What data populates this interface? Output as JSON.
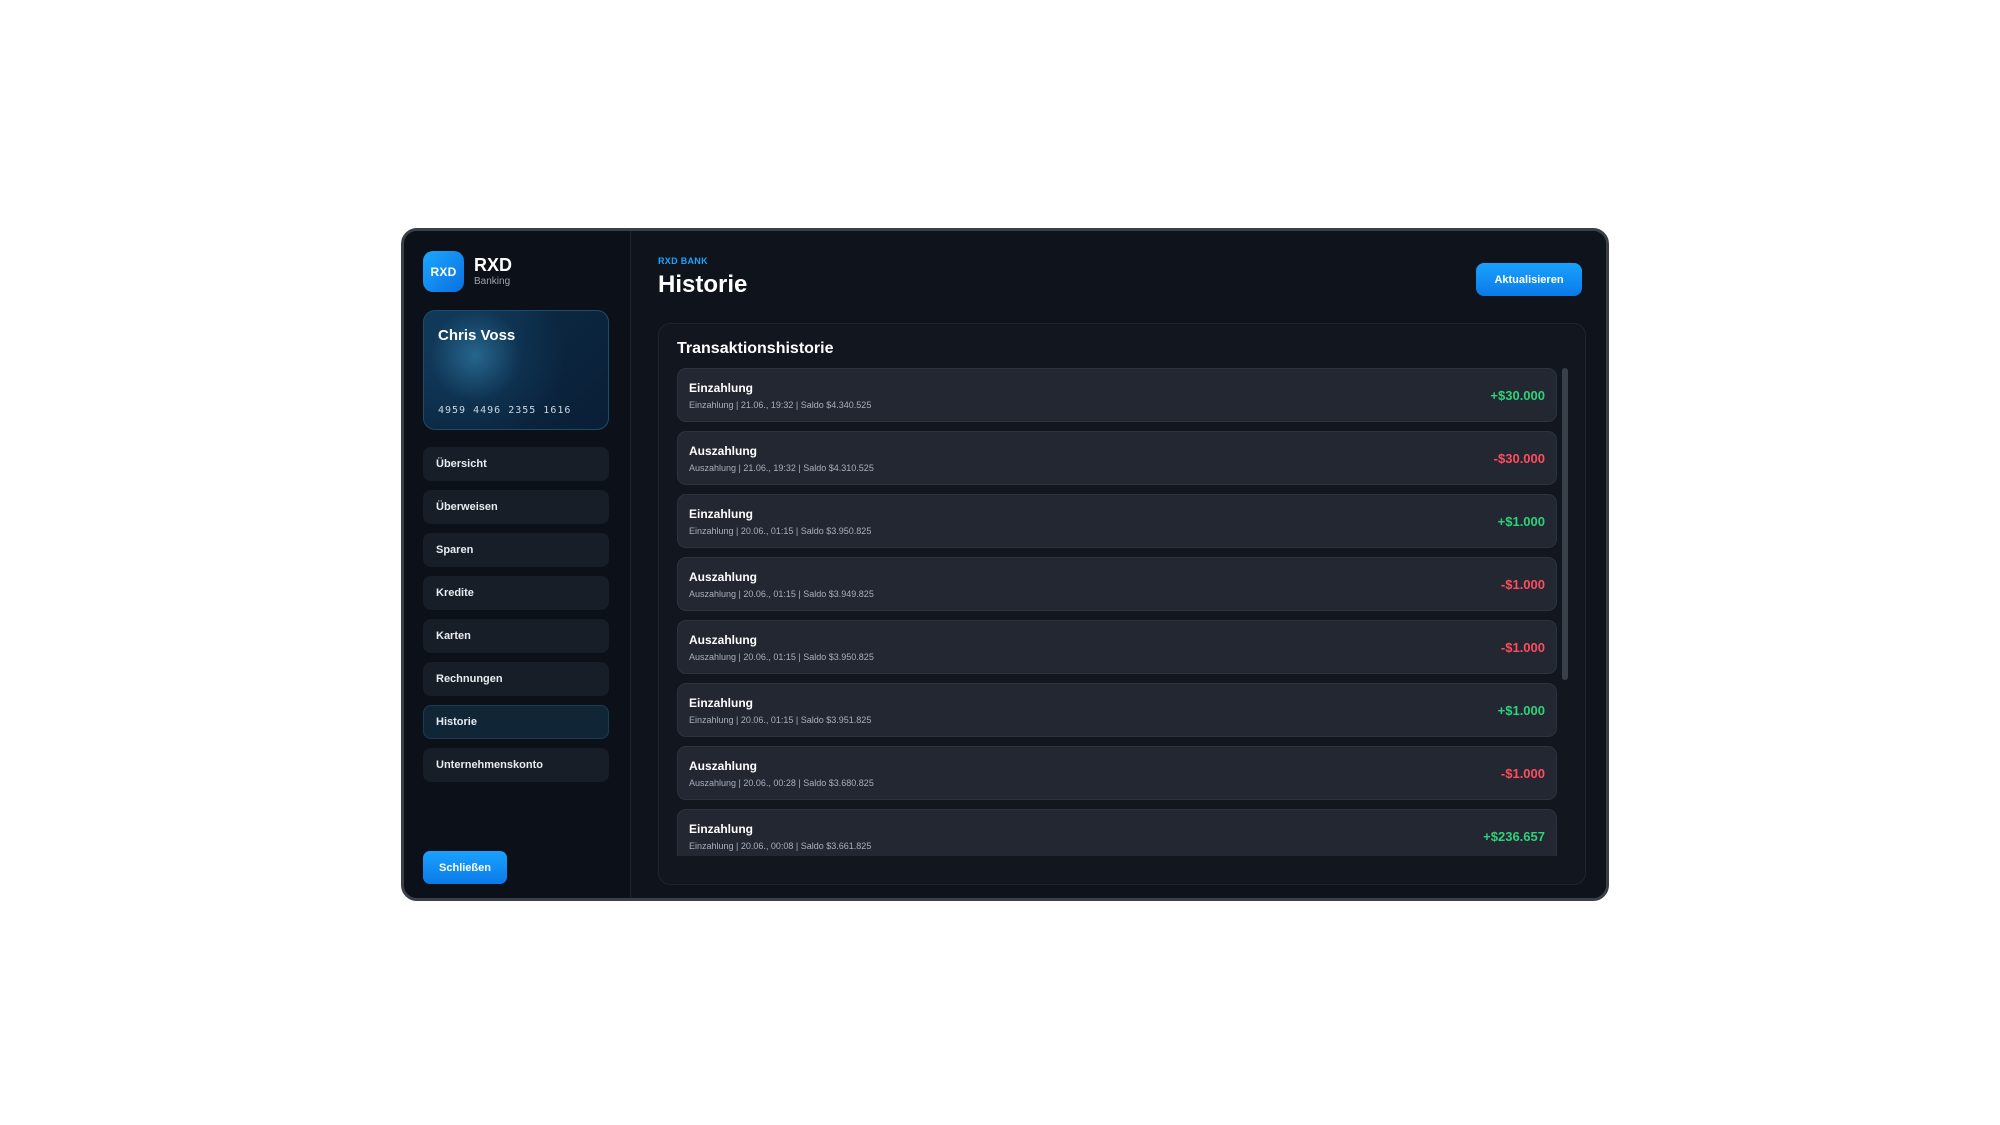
{
  "brand": {
    "logo_text": "RXD",
    "name": "RXD",
    "subtitle": "Banking"
  },
  "card": {
    "holder": "Chris Voss",
    "number": "4959 4496 2355 1616"
  },
  "nav": {
    "items": [
      {
        "label": "Übersicht",
        "active": false
      },
      {
        "label": "Überweisen",
        "active": false
      },
      {
        "label": "Sparen",
        "active": false
      },
      {
        "label": "Kredite",
        "active": false
      },
      {
        "label": "Karten",
        "active": false
      },
      {
        "label": "Rechnungen",
        "active": false
      },
      {
        "label": "Historie",
        "active": true
      },
      {
        "label": "Unternehmenskonto",
        "active": false
      }
    ]
  },
  "sidebar": {
    "close_label": "Schließen"
  },
  "header": {
    "eyebrow": "RXD BANK",
    "title": "Historie",
    "refresh_label": "Aktualisieren"
  },
  "panel": {
    "title": "Transaktionshistorie"
  },
  "transactions": [
    {
      "title": "Einzahlung",
      "meta": "Einzahlung | 21.06., 19:32 | Saldo $4.340.525",
      "amount": "+$30.000",
      "type": "credit"
    },
    {
      "title": "Auszahlung",
      "meta": "Auszahlung | 21.06., 19:32 | Saldo $4.310.525",
      "amount": "-$30.000",
      "type": "debit"
    },
    {
      "title": "Einzahlung",
      "meta": "Einzahlung | 20.06., 01:15 | Saldo $3.950.825",
      "amount": "+$1.000",
      "type": "credit"
    },
    {
      "title": "Auszahlung",
      "meta": "Auszahlung | 20.06., 01:15 | Saldo $3.949.825",
      "amount": "-$1.000",
      "type": "debit"
    },
    {
      "title": "Auszahlung",
      "meta": "Auszahlung | 20.06., 01:15 | Saldo $3.950.825",
      "amount": "-$1.000",
      "type": "debit"
    },
    {
      "title": "Einzahlung",
      "meta": "Einzahlung | 20.06., 01:15 | Saldo $3.951.825",
      "amount": "+$1.000",
      "type": "credit"
    },
    {
      "title": "Auszahlung",
      "meta": "Auszahlung | 20.06., 00:28 | Saldo $3.680.825",
      "amount": "-$1.000",
      "type": "debit"
    },
    {
      "title": "Einzahlung",
      "meta": "Einzahlung | 20.06., 00:08 | Saldo $3.661.825",
      "amount": "+$236.657",
      "type": "credit"
    }
  ],
  "colors": {
    "accent": "#1ba3ff",
    "credit": "#2fd17a",
    "debit": "#ff4d5e",
    "background": "#0f141c"
  }
}
